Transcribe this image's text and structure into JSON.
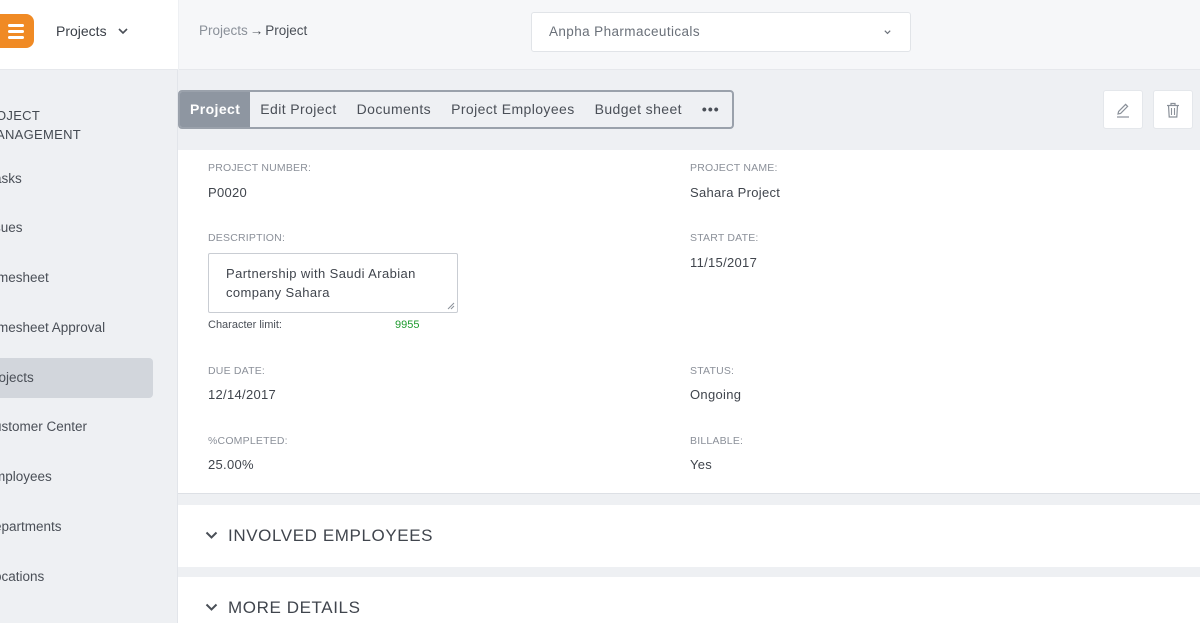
{
  "app": {
    "switcher_label": "Projects"
  },
  "sidebar": {
    "section_title_line1": "OJECT",
    "section_title_line2": "ANAGEMENT",
    "items": [
      {
        "label": "asks",
        "active": false
      },
      {
        "label": "sues",
        "active": false
      },
      {
        "label": "imesheet",
        "active": false
      },
      {
        "label": "imesheet Approval",
        "active": false
      },
      {
        "label": "rojects",
        "active": true
      },
      {
        "label": "ustomer Center",
        "active": false
      },
      {
        "label": "mployees",
        "active": false
      },
      {
        "label": "epartments",
        "active": false
      },
      {
        "label": "ocations",
        "active": false
      }
    ]
  },
  "header": {
    "breadcrumb": {
      "parent": "Projects",
      "separator": "→",
      "current": "Project"
    },
    "company_select": {
      "value": "Anpha Pharmaceuticals"
    }
  },
  "tabs": [
    {
      "label": "Project",
      "active": true
    },
    {
      "label": "Edit Project",
      "active": false
    },
    {
      "label": "Documents",
      "active": false
    },
    {
      "label": "Project Employees",
      "active": false
    },
    {
      "label": "Budget sheet",
      "active": false
    },
    {
      "label": "•••",
      "active": false
    }
  ],
  "details": {
    "project_number": {
      "label": "PROJECT NUMBER:",
      "value": "P0020"
    },
    "project_name": {
      "label": "PROJECT NAME:",
      "value": "Sahara Project"
    },
    "description": {
      "label": "DESCRIPTION:",
      "value": "Partnership with Saudi Arabian company Sahara",
      "char_limit_label": "Character limit:",
      "char_limit_value": "9955"
    },
    "start_date": {
      "label": "START DATE:",
      "value": "11/15/2017"
    },
    "due_date": {
      "label": "DUE DATE:",
      "value": "12/14/2017"
    },
    "status": {
      "label": "STATUS:",
      "value": "Ongoing"
    },
    "completed": {
      "label": "%COMPLETED:",
      "value": "25.00%"
    },
    "billable": {
      "label": "BILLABLE:",
      "value": "Yes"
    }
  },
  "sections": [
    {
      "title": "INVOLVED EMPLOYEES"
    },
    {
      "title": "MORE DETAILS"
    }
  ],
  "colors": {
    "accent": "#f08a24",
    "active_tab": "#8e96a1",
    "char_count": "#1e9a2e"
  }
}
